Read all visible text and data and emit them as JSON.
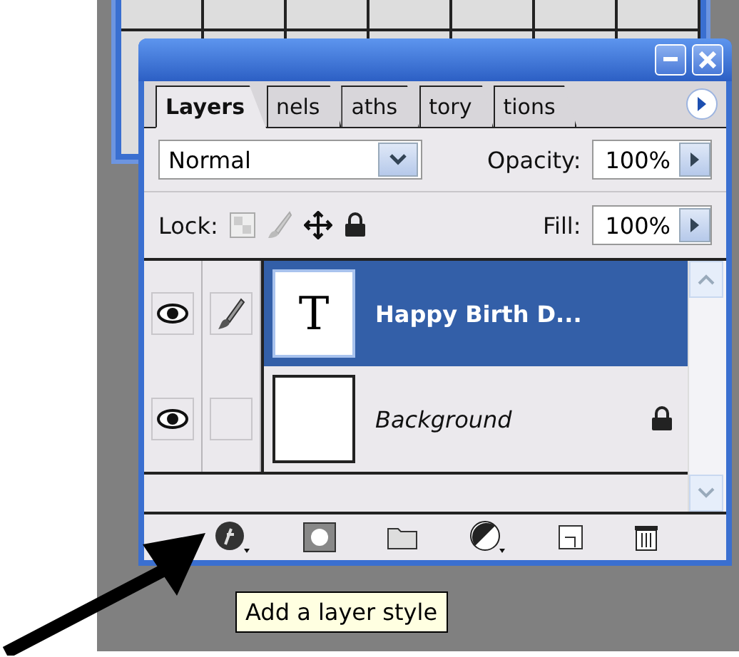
{
  "panel": {
    "tabs": [
      {
        "label": "Layers",
        "selected": true
      },
      {
        "label": "nels",
        "selected": false
      },
      {
        "label": "aths",
        "selected": false
      },
      {
        "label": "tory",
        "selected": false
      },
      {
        "label": "tions",
        "selected": false
      }
    ],
    "blend_mode": "Normal",
    "opacity": {
      "label": "Opacity:",
      "value": "100%"
    },
    "lock": {
      "label": "Lock:"
    },
    "fill": {
      "label": "Fill:",
      "value": "100%"
    },
    "layers": [
      {
        "kind": "text",
        "thumbnail": "T",
        "name": "Happy Birth D...",
        "visible": true,
        "editing": true,
        "selected": true,
        "locked": false
      },
      {
        "kind": "background",
        "name": "Background",
        "visible": true,
        "editing": false,
        "selected": false,
        "locked": true
      }
    ]
  },
  "tooltip": "Add a layer style"
}
